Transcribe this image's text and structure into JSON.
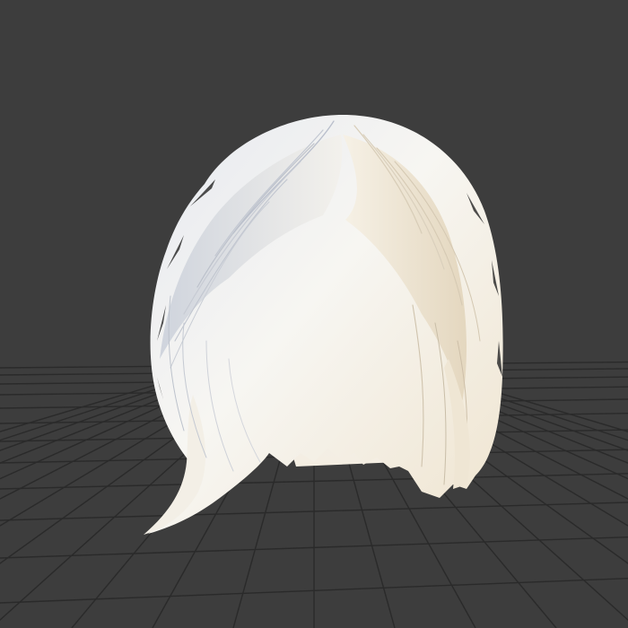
{
  "viewport": {
    "background_color": "#3d3d3d",
    "grid_line_color": "#2a2a2a",
    "grid_visible": true
  },
  "model": {
    "subject": "hair",
    "base_color": "#f4f2ee",
    "shadow_color": "#c9ccd3",
    "warm_color": "#f1e6d2",
    "edge_color": "#2b2b2b"
  }
}
